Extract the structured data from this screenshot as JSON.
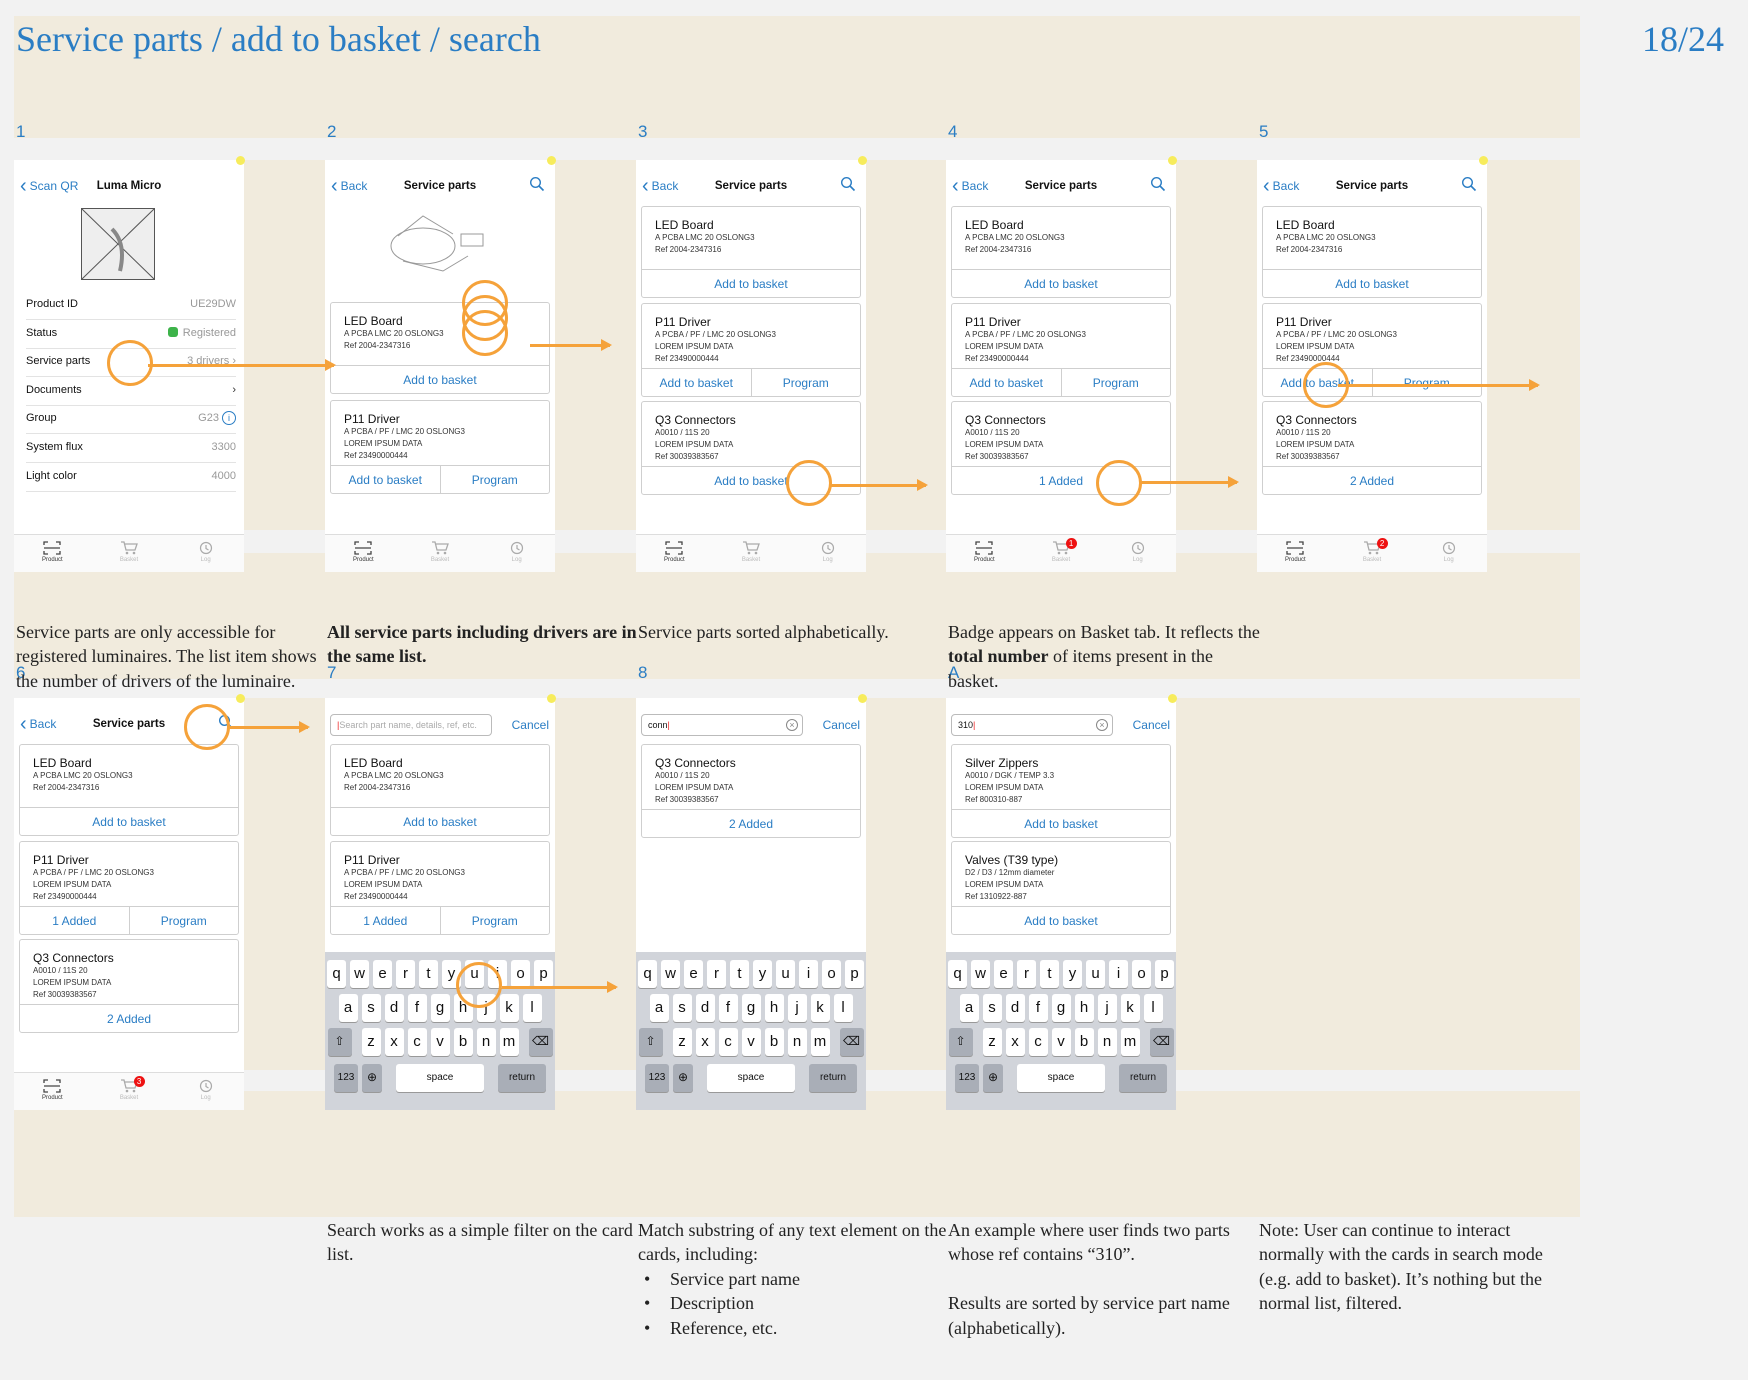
{
  "header": {
    "title": "Service parts / add to basket / search",
    "page": "18/24"
  },
  "labels": [
    "1",
    "2",
    "3",
    "4",
    "5",
    "6",
    "7",
    "8",
    "A"
  ],
  "captions_top": [
    {
      "segs": [
        {
          "t": "Service parts are only accessible for registered luminaires. The list item shows the number of drivers of the luminaire."
        }
      ]
    },
    {
      "segs": [
        {
          "t": "All service parts including drivers are in the same list.",
          "b": true
        }
      ]
    },
    {
      "segs": [
        {
          "t": "Service parts sorted alphabetically."
        }
      ]
    },
    {
      "segs": [
        {
          "t": "Badge appears on Basket tab. It reflects the "
        },
        {
          "t": "total number",
          "b": true
        },
        {
          "t": " of items present in the basket."
        }
      ]
    }
  ],
  "captions_bottom": {
    "c7": "Search works as a simple filter on the card list.",
    "c8_intro": "Match substring of any text element on the cards, including:",
    "c8_items": [
      "Service part name",
      "Description",
      "Reference, etc."
    ],
    "cA_1": "An example where user finds two parts whose ref contains “310”.",
    "cA_2": "Results are sorted by service part name (alphabetically).",
    "cN": "Note:  User can continue to interact normally with the cards in search mode (e.g. add to basket). It’s nothing but the normal list, filtered."
  },
  "common": {
    "back": "Back",
    "title": "Service parts",
    "add": "Add to basket",
    "program": "Program",
    "cancel": "Cancel",
    "tabs": [
      "Product",
      "Basket",
      "Log"
    ]
  },
  "parts": {
    "led": {
      "name": "LED Board",
      "lines": [
        "A PCBA LMC 20 OSLONG3",
        "Ref 2004-2347316"
      ]
    },
    "p11": {
      "name": "P11 Driver",
      "lines": [
        "A PCBA / PF / LMC 20 OSLONG3",
        "LOREM IPSUM DATA",
        "Ref 23490000444"
      ]
    },
    "q3": {
      "name": "Q3 Connectors",
      "lines": [
        "A0010 / 11S 20",
        "LOREM IPSUM DATA",
        "Ref 30039383567"
      ]
    },
    "sz": {
      "name": "Silver Zippers",
      "lines": [
        "A0010 / DGK / TEMP 3.3",
        "LOREM IPSUM DATA",
        "Ref 800310-887"
      ]
    },
    "va": {
      "name": "Valves (T39 type)",
      "lines": [
        "D2 / D3 / 12mm diameter",
        "LOREM IPSUM DATA",
        "Ref 1310922-887"
      ]
    }
  },
  "added": {
    "one": "1 Added",
    "two": "2 Added"
  },
  "badge": {
    "two": "2",
    "three": "3"
  },
  "screen1": {
    "back": "Scan QR",
    "title": "Luma Micro",
    "rows": [
      {
        "k": "Product ID",
        "v": "UE29DW"
      },
      {
        "k": "Status",
        "v": "Registered"
      },
      {
        "k": "Service parts",
        "v": "3 drivers"
      },
      {
        "k": "Documents",
        "v": ""
      },
      {
        "k": "Group",
        "v": "G23"
      },
      {
        "k": "System flux",
        "v": "3300"
      },
      {
        "k": "Light color",
        "v": "4000"
      }
    ]
  },
  "search": {
    "placeholder": "Search part name, details, ref, etc.",
    "q8": "conn",
    "qA": "310"
  },
  "keyboard": {
    "r1": [
      "q",
      "w",
      "e",
      "r",
      "t",
      "y",
      "u",
      "i",
      "o",
      "p"
    ],
    "r2": [
      "a",
      "s",
      "d",
      "f",
      "g",
      "h",
      "j",
      "k",
      "l"
    ],
    "r3": [
      "z",
      "x",
      "c",
      "v",
      "b",
      "n",
      "m"
    ],
    "k123": "123",
    "space": "space",
    "ret": "return"
  },
  "colors": {
    "accent": "#2a7dc4",
    "annotation": "#f5a23a",
    "panel": "#f1ebdd",
    "badge": "#e11111"
  },
  "icons": [
    "search-icon",
    "scan-icon",
    "basket-icon",
    "log-icon",
    "chevron-left-icon",
    "info-icon"
  ]
}
